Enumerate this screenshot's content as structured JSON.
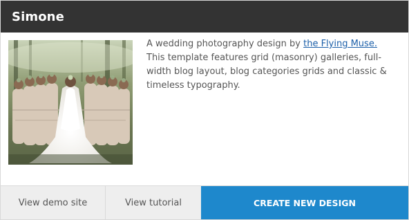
{
  "card": {
    "title": "Simone",
    "description_prefix": "A wedding photography design by ",
    "description_link": "the Flying Muse.",
    "description_suffix": " This template features grid (masonry) galleries, full-width blog layout, blog categories grids and classic & timeless typography."
  },
  "actions": {
    "demo_label": "View demo site",
    "tutorial_label": "View tutorial",
    "create_label": "CREATE NEW DESIGN"
  },
  "colors": {
    "header_bg": "#333333",
    "primary": "#1e88cc",
    "link": "#1a5ea8",
    "secondary_bg": "#eeeeee"
  }
}
